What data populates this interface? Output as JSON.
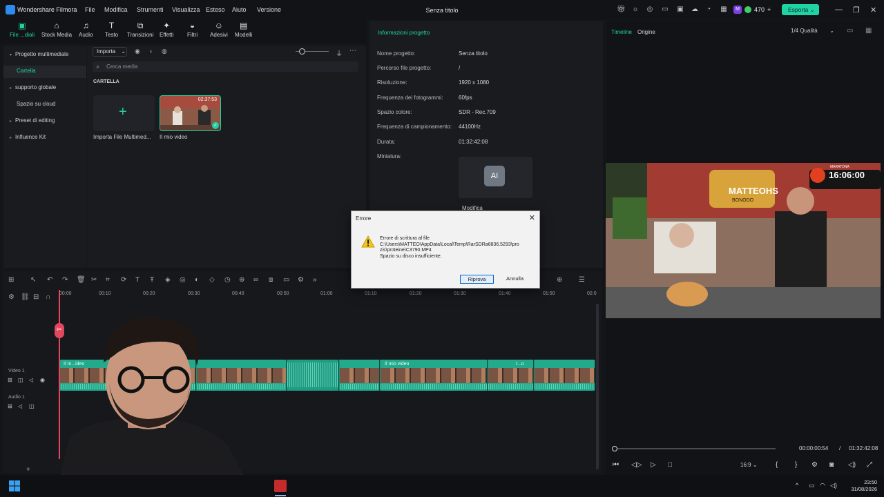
{
  "app": {
    "name": "Wondershare Filmora",
    "doc_title": "Senza titolo",
    "menu": [
      "File",
      "Modifica",
      "Strumenti",
      "Visualizza",
      "Esteso",
      "Aiuto",
      "Versione"
    ],
    "credits": "470",
    "credits_badge": "M",
    "export_label": "Esporta"
  },
  "toolbar": {
    "items": [
      "File ...diali",
      "Stock Media",
      "Audio",
      "Testo",
      "Transizioni",
      "Effetti",
      "Filtri",
      "Adesivi",
      "Modelli"
    ]
  },
  "leftnav": {
    "items": [
      {
        "label": "Progetto multimediale",
        "arrow": "▾"
      },
      {
        "label": "Cartella",
        "arrow": ""
      },
      {
        "label": "supporto globale",
        "arrow": "▸"
      },
      {
        "label": "Spazio su cloud",
        "arrow": ""
      },
      {
        "label": "Preset di editing",
        "arrow": "▸"
      },
      {
        "label": "Influence Kit",
        "arrow": "▸"
      }
    ]
  },
  "media": {
    "import_label": "Importa",
    "search_placeholder": "Cerca media",
    "section": "CARTELLA",
    "import_card_label": "Importa File Multimed...",
    "video_card_label": "Il mio video",
    "video_duration": "02:37:53"
  },
  "info": {
    "header": "Informazioni progetto",
    "rows": [
      {
        "k": "Nome progetto:",
        "v": "Senza titolo"
      },
      {
        "k": "Percorso file progetto:",
        "v": "/"
      },
      {
        "k": "Risoluzione:",
        "v": "1920 x 1080"
      },
      {
        "k": "Frequenza dei fotogrammi:",
        "v": "60fps"
      },
      {
        "k": "Spazio colore:",
        "v": "SDR - Rec.709"
      },
      {
        "k": "Frequenza di campionamento:",
        "v": "44100Hz"
      },
      {
        "k": "Durata:",
        "v": "01:32:42:08"
      },
      {
        "k": "Miniatura:",
        "v": ""
      }
    ],
    "edit_label": "Modifica",
    "thumb_text": "AI"
  },
  "player": {
    "tab_timeline": "Timeline",
    "tab_origine": "Origine",
    "quality": "1/4 Qualità",
    "current_time": "00:00:00:54",
    "separator": "/",
    "total_time": "01:32:42:08",
    "aspect": "16:9",
    "video_overlay_time": "16:06:00",
    "video_overlay_label": "MARATONA",
    "video_sign": "MATTEOHS",
    "video_sign_sub": "BONODO"
  },
  "timeline": {
    "ticks": [
      "00:00",
      "00:10",
      "00:20",
      "00:30",
      "00:40",
      "00:50",
      "01:00",
      "01:10",
      "01:20",
      "01:30",
      "01:40",
      "01:50",
      "02:0"
    ],
    "video_track": "Video 1",
    "audio_track": "Audio 1",
    "clip_labels": [
      "Il m...ideo",
      "Il mio video",
      "I...o"
    ]
  },
  "dialog": {
    "title": "Errore",
    "lines": [
      "Errore di scrittura al file",
      "C:\\Users\\MATTEO\\AppData\\Local\\Temp\\RarSDRa6836.5293\\pro",
      "zis\\proteine\\C3790.MP4",
      "Spazio su disco insufficiente."
    ],
    "retry": "Riprova",
    "cancel": "Annulla"
  },
  "taskbar": {
    "time": "23:50",
    "date": "31/08/2026"
  },
  "colors": {
    "accent": "#1fd3a4",
    "playhead": "#e2475f",
    "clip": "#23a98c"
  }
}
